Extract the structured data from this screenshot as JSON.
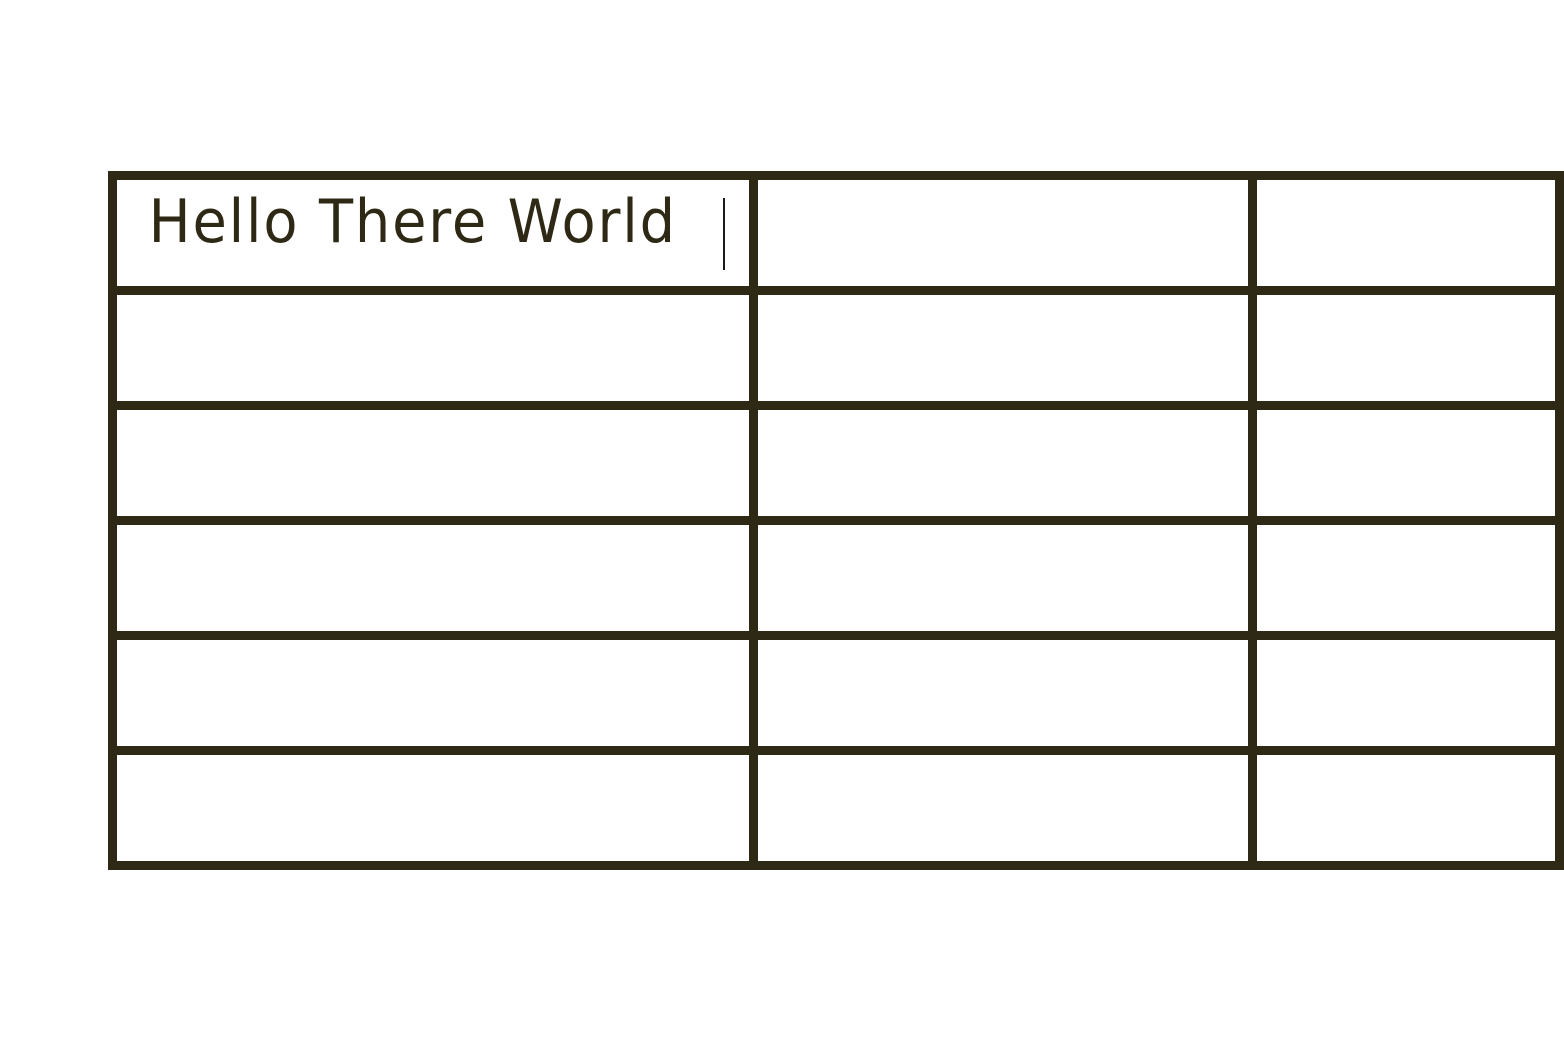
{
  "document": {
    "table": {
      "rows": [
        [
          "Hello There World",
          "",
          ""
        ],
        [
          "",
          "",
          ""
        ],
        [
          "",
          "",
          ""
        ],
        [
          "",
          "",
          ""
        ],
        [
          "",
          "",
          ""
        ],
        [
          "",
          "",
          ""
        ]
      ],
      "active_cell": {
        "row": 0,
        "col": 0
      },
      "border_color": "#2e2915"
    }
  }
}
